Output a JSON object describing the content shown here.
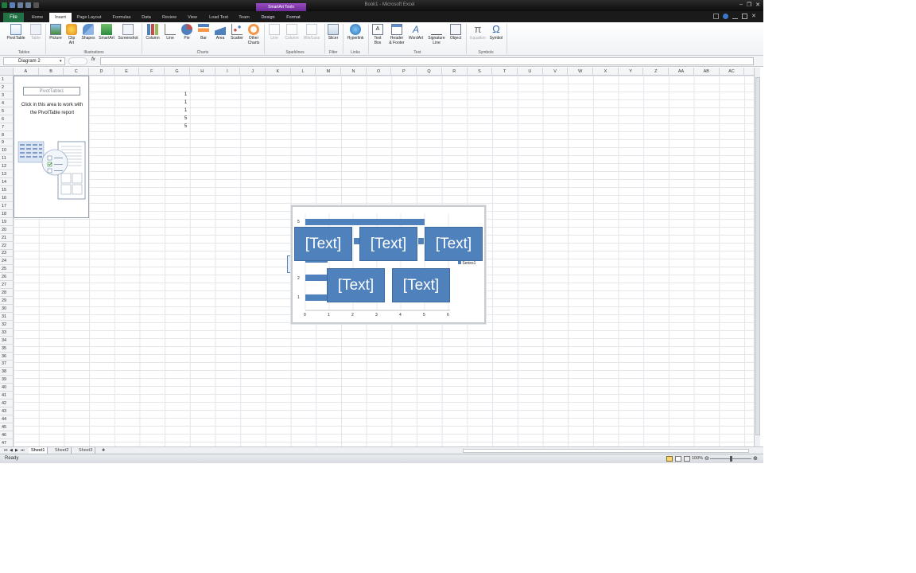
{
  "window": {
    "title": "Book1 - Microsoft Excel",
    "context_group": "SmartArt Tools"
  },
  "tabs": {
    "file": "File",
    "items": [
      "Home",
      "Insert",
      "Page Layout",
      "Formulas",
      "Data",
      "Review",
      "View",
      "Load Test",
      "Team"
    ],
    "active": "Insert",
    "context_items": [
      "Design",
      "Format"
    ]
  },
  "ribbon": {
    "tables": {
      "label": "Tables",
      "pivottable": "PivotTable",
      "table": "Table"
    },
    "illustrations": {
      "label": "Illustrations",
      "picture": "Picture",
      "clip_art_1": "Clip",
      "clip_art_2": "Art",
      "shapes": "Shapes",
      "smartart": "SmartArt",
      "screenshot": "Screenshot"
    },
    "charts": {
      "label": "Charts",
      "column": "Column",
      "line": "Line",
      "pie": "Pie",
      "bar": "Bar",
      "area": "Area",
      "scatter": "Scatter",
      "other_1": "Other",
      "other_2": "Charts"
    },
    "sparklines": {
      "label": "Sparklines",
      "line": "Line",
      "column": "Column",
      "winloss": "Win/Loss"
    },
    "filter": {
      "label": "Filter",
      "slicer": "Slicer"
    },
    "links": {
      "label": "Links",
      "hyperlink": "Hyperlink"
    },
    "text": {
      "label": "Text",
      "textbox_1": "Text",
      "textbox_2": "Box",
      "header_1": "Header",
      "header_2": "& Footer",
      "wordart": "WordArt",
      "signature_1": "Signature",
      "signature_2": "Line",
      "object": "Object"
    },
    "symbols": {
      "label": "Symbols",
      "equation": "Equation",
      "symbol": "Symbol"
    }
  },
  "formula_bar": {
    "name_box": "Diagram 2",
    "fx": "fx",
    "value": ""
  },
  "columns": [
    "A",
    "B",
    "C",
    "D",
    "E",
    "F",
    "G",
    "H",
    "I",
    "J",
    "K",
    "L",
    "M",
    "N",
    "O",
    "P",
    "Q",
    "R",
    "S",
    "T",
    "U",
    "V",
    "W",
    "X",
    "Y",
    "Z",
    "AA",
    "AB",
    "AC"
  ],
  "rows": [
    "1",
    "2",
    "3",
    "4",
    "5",
    "6",
    "7",
    "8",
    "9",
    "10",
    "11",
    "12",
    "13",
    "14",
    "15",
    "16",
    "17",
    "18",
    "19",
    "20",
    "21",
    "22",
    "23",
    "24",
    "25",
    "26",
    "27",
    "28",
    "29",
    "30",
    "31",
    "32",
    "33",
    "34",
    "35",
    "36",
    "37",
    "38",
    "39",
    "40",
    "41",
    "42",
    "43",
    "44",
    "45",
    "46",
    "47"
  ],
  "cells": [
    {
      "ref": "G3",
      "value": "1"
    },
    {
      "ref": "G4",
      "value": "1"
    },
    {
      "ref": "G5",
      "value": "1"
    },
    {
      "ref": "G6",
      "value": "5"
    },
    {
      "ref": "G7",
      "value": "5"
    }
  ],
  "pivot": {
    "name": "PivotTable1",
    "message_1": "Click in this area to work with",
    "message_2": "the PivotTable report"
  },
  "chart": {
    "smartart_boxes": [
      "[Text]",
      "[Text]",
      "[Text]",
      "[Text]",
      "[Text]"
    ],
    "legend": "Series1",
    "x_ticks": [
      "0",
      "1",
      "2",
      "3",
      "4",
      "5",
      "6"
    ],
    "y_ticks": [
      "5",
      "2",
      "1"
    ]
  },
  "sheets": {
    "items": [
      "Sheet1",
      "Sheet2",
      "Sheet3"
    ],
    "active": "Sheet1"
  },
  "status": {
    "ready": "Ready",
    "zoom": "100%"
  },
  "colors": {
    "accent_blue": "#4f81bd",
    "excel_green": "#217346",
    "smartart_purple": "#7b34ad"
  }
}
